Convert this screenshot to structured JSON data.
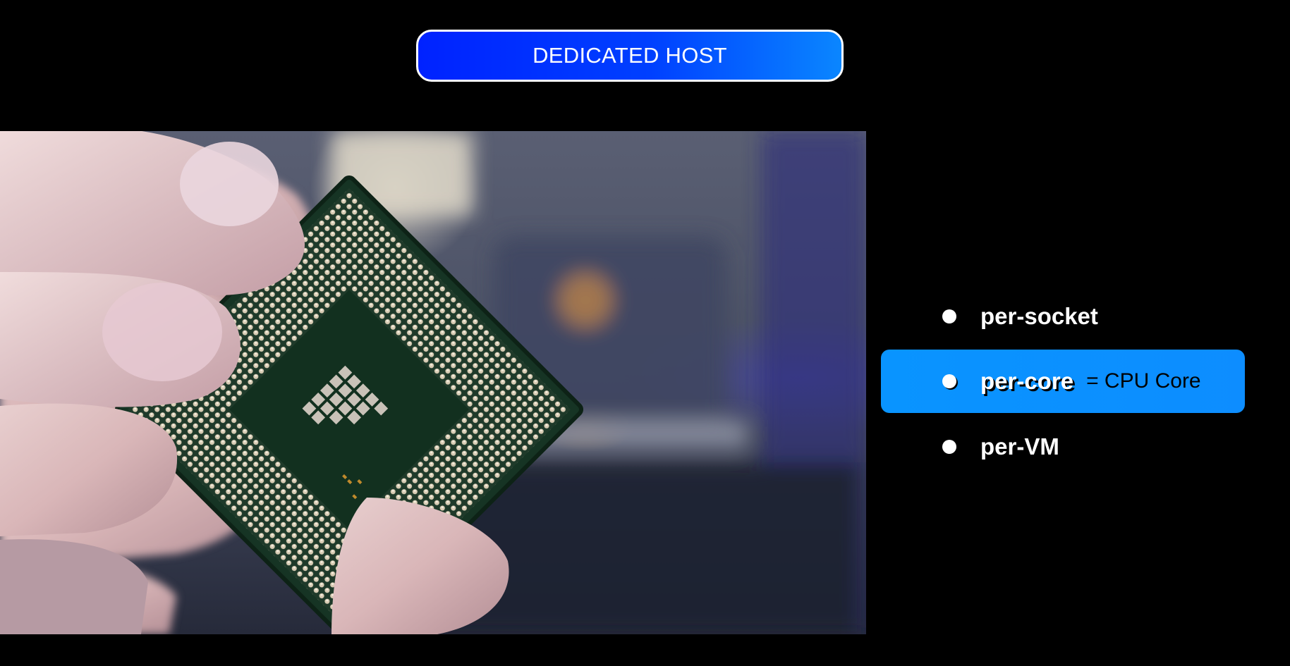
{
  "header": {
    "title": "DEDICATED HOST"
  },
  "photo": {
    "icon": "cpu-in-hand-photo"
  },
  "list": {
    "items": [
      {
        "label": "per-socket"
      },
      {
        "label": "per-core",
        "note": "= CPU Core",
        "highlighted": true
      },
      {
        "label": "per-VM"
      }
    ]
  },
  "colors": {
    "title_gradient_start": "#0022ff",
    "title_gradient_end": "#0a86ff",
    "highlight": "#0994ff",
    "background": "#000000"
  }
}
